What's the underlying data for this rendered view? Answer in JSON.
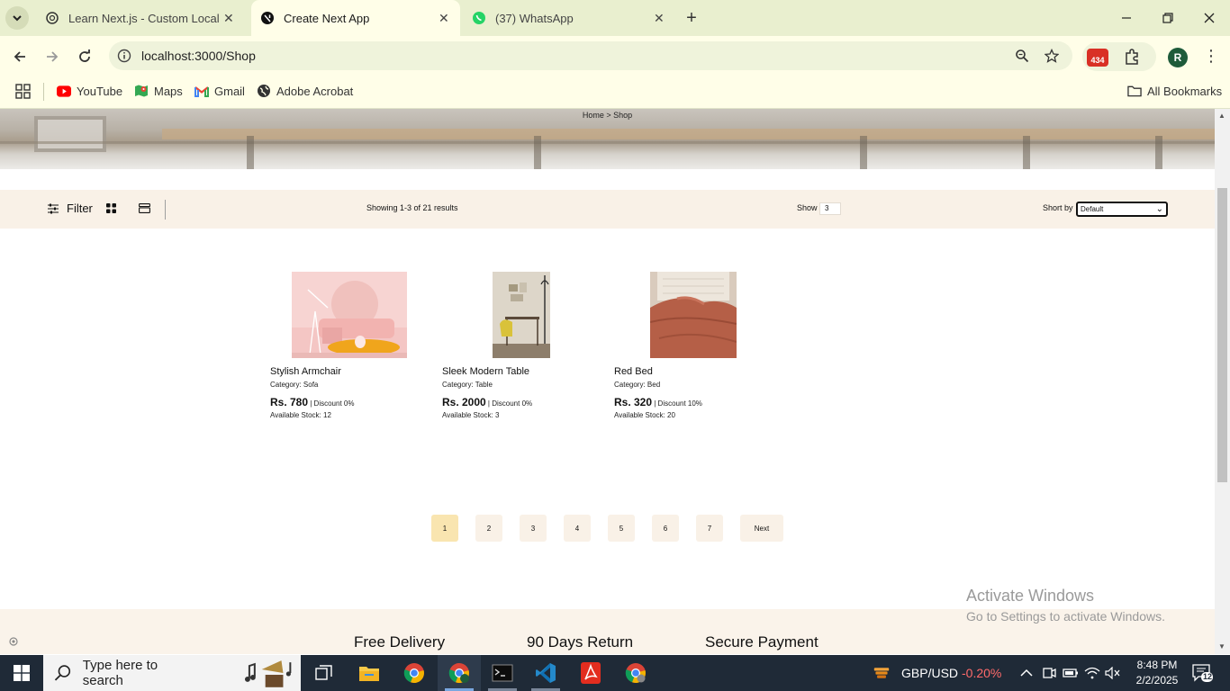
{
  "browser": {
    "tabs": [
      {
        "title": "Learn Next.js - Custom Localhost"
      },
      {
        "title": "Create Next App"
      },
      {
        "title": "(37) WhatsApp"
      }
    ],
    "url": "localhost:3000/Shop",
    "extension_badge": "434",
    "profile_initial": "R",
    "bookmarks": [
      {
        "label": "YouTube"
      },
      {
        "label": "Maps"
      },
      {
        "label": "Gmail"
      },
      {
        "label": "Adobe Acrobat"
      }
    ],
    "all_bookmarks": "All Bookmarks"
  },
  "page": {
    "breadcrumb": "Home  >  Shop",
    "filter": {
      "filter_label": "Filter",
      "results_text": "Showing 1-3 of 21 results",
      "show_label": "Show",
      "show_value": "3",
      "sort_label": "Short by",
      "sort_value": "Default"
    },
    "products": [
      {
        "name": "Stylish Armchair",
        "category": "Category: Sofa",
        "price": "Rs. 780",
        "discount": " | Discount 0%",
        "stock": "Available Stock: 12"
      },
      {
        "name": "Sleek Modern Table",
        "category": "Category: Table",
        "price": "Rs. 2000",
        "discount": " | Discount 0%",
        "stock": "Available Stock: 3"
      },
      {
        "name": "Red Bed",
        "category": "Category: Bed",
        "price": "Rs. 320",
        "discount": " | Discount 10%",
        "stock": "Available Stock: 20"
      }
    ],
    "pagination": {
      "pages": [
        "1",
        "2",
        "3",
        "4",
        "5",
        "6",
        "7"
      ],
      "current": "1",
      "next_label": "Next"
    },
    "features": [
      "Free Delivery",
      "90 Days Return",
      "Secure Payment"
    ],
    "watermark": {
      "title": "Activate Windows",
      "subtitle": "Go to Settings to activate Windows."
    }
  },
  "taskbar": {
    "search_placeholder": "Type here to search",
    "ticker": "GBP/USD",
    "ticker_change": "-0.20%",
    "time": "8:48 PM",
    "date": "2/2/2025",
    "notifications": "12"
  },
  "colors": {
    "chrome_frame": "#e9efcf",
    "chrome_toolbar": "#fffee8",
    "filterbar_bg": "#f9f1e7",
    "active_page": "#f9e5b0",
    "taskbar": "#1f2a37",
    "ticker_negative": "#ff6b6b"
  }
}
